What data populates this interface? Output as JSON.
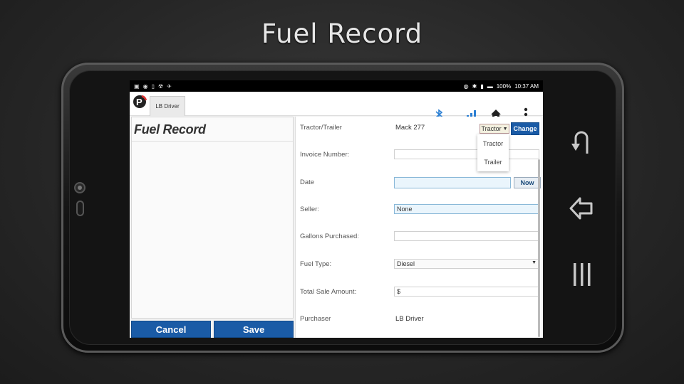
{
  "slide": {
    "title": "Fuel Record"
  },
  "statusbar": {
    "battery": "100%",
    "time": "10:37 AM"
  },
  "appbar": {
    "driver_tab": "LB Driver"
  },
  "left_panel": {
    "title": "Fuel Record"
  },
  "buttons": {
    "cancel": "Cancel",
    "save": "Save",
    "change": "Change",
    "now": "Now"
  },
  "form": {
    "tractor_trailer": {
      "label": "Tractor/Trailer",
      "value": "Mack 277",
      "select_value": "Tractor"
    },
    "invoice_number": {
      "label": "Invoice Number:",
      "value": ""
    },
    "date": {
      "label": "Date",
      "value": ""
    },
    "seller": {
      "label": "Seller:",
      "value": "None"
    },
    "gallons_purchased": {
      "label": "Gallons Purchased:",
      "value": ""
    },
    "fuel_type": {
      "label": "Fuel Type:",
      "value": "Diesel"
    },
    "total_sale_amount": {
      "label": "Total Sale Amount:",
      "value": "$"
    },
    "purchaser": {
      "label": "Purchaser",
      "value": "LB Driver"
    }
  },
  "dropdown_options": [
    "Tractor",
    "Trailer"
  ],
  "colors": {
    "accent_blue": "#1a5ba6",
    "icon_blue": "#2b7fd3"
  }
}
